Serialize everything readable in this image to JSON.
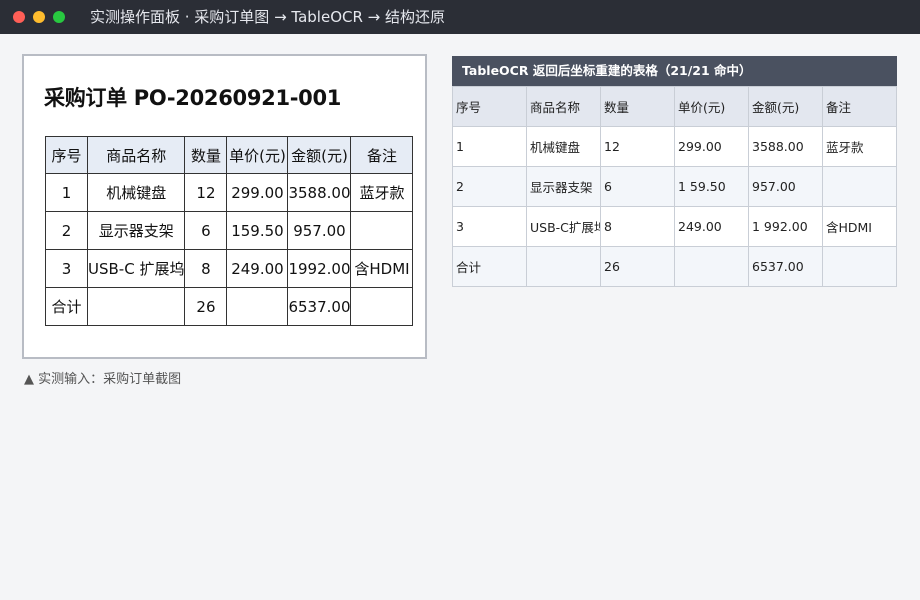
{
  "window": {
    "title": "实测操作面板 · 采购订单图 → TableOCR → 结构还原"
  },
  "source": {
    "doc_title": "采购订单 PO-20260921-001",
    "headers": [
      "序号",
      "商品名称",
      "数量",
      "单价(元)",
      "金额(元)",
      "备注"
    ],
    "rows": [
      [
        "1",
        "机械键盘",
        "12",
        "299.00",
        "3588.00",
        "蓝牙款"
      ],
      [
        "2",
        "显示器支架",
        "6",
        "159.50",
        "957.00",
        ""
      ],
      [
        "3",
        "USB-C 扩展坞",
        "8",
        "249.00",
        "1992.00",
        "含HDMI"
      ],
      [
        "合计",
        "",
        "26",
        "",
        "6537.00",
        ""
      ]
    ],
    "caption": "▲ 实测输入：采购订单截图"
  },
  "result": {
    "header": "TableOCR 返回后坐标重建的表格（21/21 命中）",
    "headers": [
      "序号",
      "商品名称",
      "数量",
      "单价(元)",
      "金额(元)",
      "备注"
    ],
    "rows": [
      [
        "1",
        "机械键盘",
        "12",
        "299.00",
        "3588.00",
        "蓝牙款"
      ],
      [
        "2",
        "显示器支架",
        "6",
        "1 59.50",
        "957.00",
        ""
      ],
      [
        "3",
        "USB-C扩展坞",
        "8",
        "249.00",
        "1 992.00",
        "含HDMI"
      ],
      [
        "合计",
        "",
        "26",
        "",
        "6537.00",
        ""
      ]
    ]
  },
  "colors": {
    "titlebar": "#2b2e36",
    "result_header": "#4a5160",
    "close": "#ff5f57",
    "minimize": "#febc2e",
    "maximize": "#28c840"
  }
}
